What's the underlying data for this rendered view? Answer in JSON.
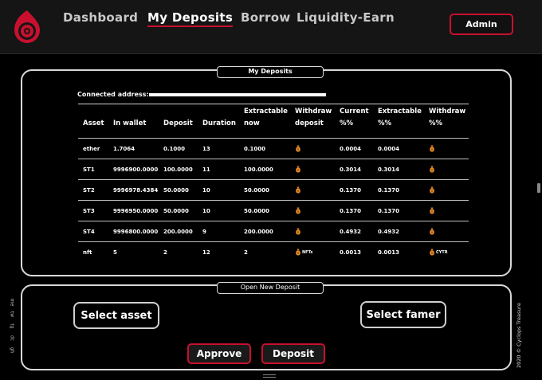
{
  "header": {
    "nav": [
      "Dashboard",
      "My Deposits",
      "Borrow",
      "Liquidity-Earn"
    ],
    "active": "My Deposits",
    "admin_label": "Admin"
  },
  "deposits_panel": {
    "title": "My Deposits",
    "connected_label": "Connected address:",
    "columns": [
      "Asset",
      "In wallet",
      "Deposit",
      "Duration",
      "Extractable now",
      "Withdraw deposit",
      "Current %%",
      "Extractable %%",
      "Withdraw %%"
    ],
    "rows": [
      {
        "asset": "ether",
        "in_wallet": "1.7064",
        "deposit": "0.1000",
        "duration": "13",
        "extractable_now": "0.1000",
        "withdraw_deposit_suffix": "",
        "current_pct": "0.0004",
        "extractable_pct": "0.0004",
        "withdraw_pct_suffix": ""
      },
      {
        "asset": "ST1",
        "in_wallet": "9996900.0000",
        "deposit": "100.0000",
        "duration": "11",
        "extractable_now": "100.0000",
        "withdraw_deposit_suffix": "",
        "current_pct": "0.3014",
        "extractable_pct": "0.3014",
        "withdraw_pct_suffix": ""
      },
      {
        "asset": "ST2",
        "in_wallet": "9996978.4384",
        "deposit": "50.0000",
        "duration": "10",
        "extractable_now": "50.0000",
        "withdraw_deposit_suffix": "",
        "current_pct": "0.1370",
        "extractable_pct": "0.1370",
        "withdraw_pct_suffix": ""
      },
      {
        "asset": "ST3",
        "in_wallet": "9996950.0000",
        "deposit": "50.0000",
        "duration": "10",
        "extractable_now": "50.0000",
        "withdraw_deposit_suffix": "",
        "current_pct": "0.1370",
        "extractable_pct": "0.1370",
        "withdraw_pct_suffix": ""
      },
      {
        "asset": "ST4",
        "in_wallet": "9996800.0000",
        "deposit": "200.0000",
        "duration": "9",
        "extractable_now": "200.0000",
        "withdraw_deposit_suffix": "",
        "current_pct": "0.4932",
        "extractable_pct": "0.4932",
        "withdraw_pct_suffix": ""
      },
      {
        "asset": "nft",
        "in_wallet": "5",
        "deposit": "2",
        "duration": "12",
        "extractable_now": "2",
        "withdraw_deposit_suffix": "NFTs",
        "current_pct": "0.0013",
        "extractable_pct": "0.0013",
        "withdraw_pct_suffix": "CYTR"
      }
    ]
  },
  "new_deposit_panel": {
    "title": "Open New Deposit",
    "select_asset": "Select asset",
    "select_famer": "Select famer",
    "approve": "Approve",
    "deposit": "Deposit"
  },
  "sidebar_links": [
    "me",
    "tw",
    "tg",
    "dc",
    "gh"
  ],
  "footer": {
    "copyright": "2020 © Cyclops Treasure"
  },
  "icons": {
    "withdraw": "money-bag-icon",
    "logo": "cyclops-logo-icon"
  },
  "colors": {
    "accent": "#c8102e",
    "background": "#000000",
    "header": "#151515",
    "bag": "#e08a2a"
  }
}
